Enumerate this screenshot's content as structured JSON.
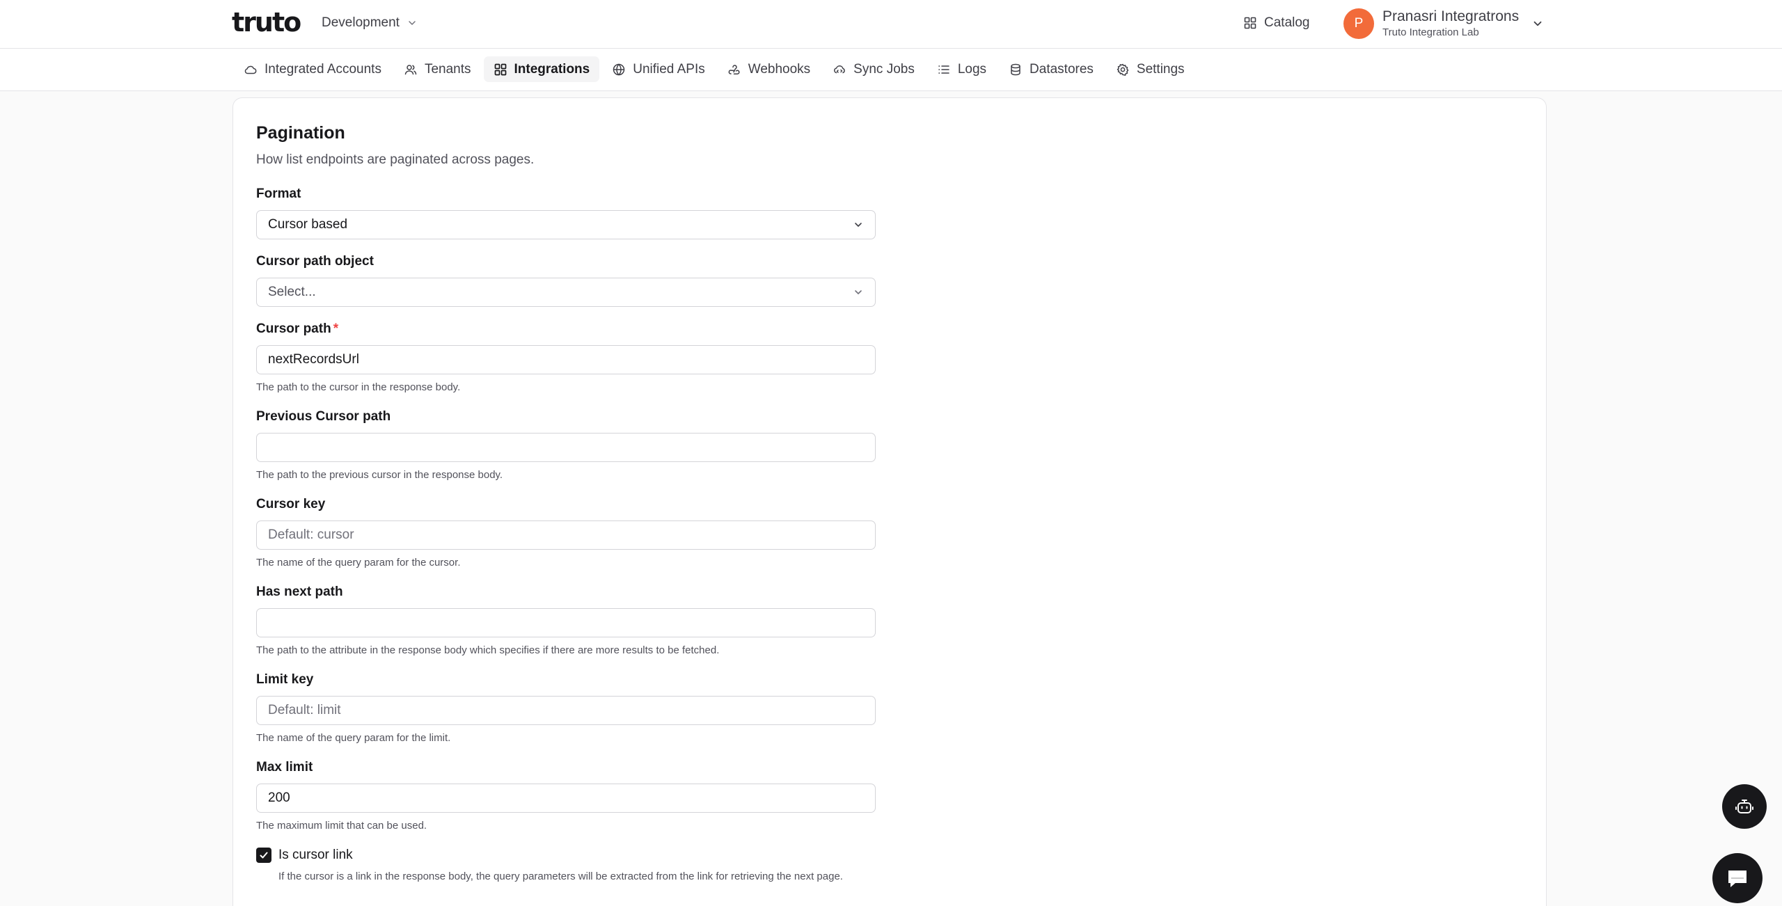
{
  "header": {
    "logo_text": "truto",
    "environment": "Development",
    "catalog_label": "Catalog",
    "user": {
      "initial": "P",
      "name": "Pranasri Integratrons",
      "org": "Truto Integration Lab",
      "avatar_color": "#f26b3a"
    }
  },
  "nav": {
    "items": [
      {
        "label": "Integrated Accounts",
        "icon": "cloud-icon"
      },
      {
        "label": "Tenants",
        "icon": "users-icon"
      },
      {
        "label": "Integrations",
        "icon": "grid-icon",
        "active": true
      },
      {
        "label": "Unified APIs",
        "icon": "globe-icon"
      },
      {
        "label": "Webhooks",
        "icon": "webhook-icon"
      },
      {
        "label": "Sync Jobs",
        "icon": "cloud-sync-icon"
      },
      {
        "label": "Logs",
        "icon": "list-icon"
      },
      {
        "label": "Datastores",
        "icon": "database-icon"
      },
      {
        "label": "Settings",
        "icon": "gear-icon"
      }
    ]
  },
  "pagination": {
    "title": "Pagination",
    "description": "How list endpoints are paginated across pages.",
    "format": {
      "label": "Format",
      "value": "Cursor based"
    },
    "cursor_path_object": {
      "label": "Cursor path object",
      "placeholder": "Select..."
    },
    "cursor_path": {
      "label": "Cursor path",
      "required_mark": "*",
      "value": "nextRecordsUrl",
      "help": "The path to the cursor in the response body."
    },
    "previous_cursor_path": {
      "label": "Previous Cursor path",
      "value": "",
      "help": "The path to the previous cursor in the response body."
    },
    "cursor_key": {
      "label": "Cursor key",
      "placeholder": "Default: cursor",
      "help": "The name of the query param for the cursor."
    },
    "has_next_path": {
      "label": "Has next path",
      "value": "",
      "help": "The path to the attribute in the response body which specifies if there are more results to be fetched."
    },
    "limit_key": {
      "label": "Limit key",
      "placeholder": "Default: limit",
      "help": "The name of the query param for the limit."
    },
    "max_limit": {
      "label": "Max limit",
      "value": "200",
      "help": "The maximum limit that can be used."
    },
    "is_cursor_link": {
      "label": "Is cursor link",
      "checked": true,
      "help": "If the cursor is a link in the response body, the query parameters will be extracted from the link for retrieving the next page."
    }
  }
}
